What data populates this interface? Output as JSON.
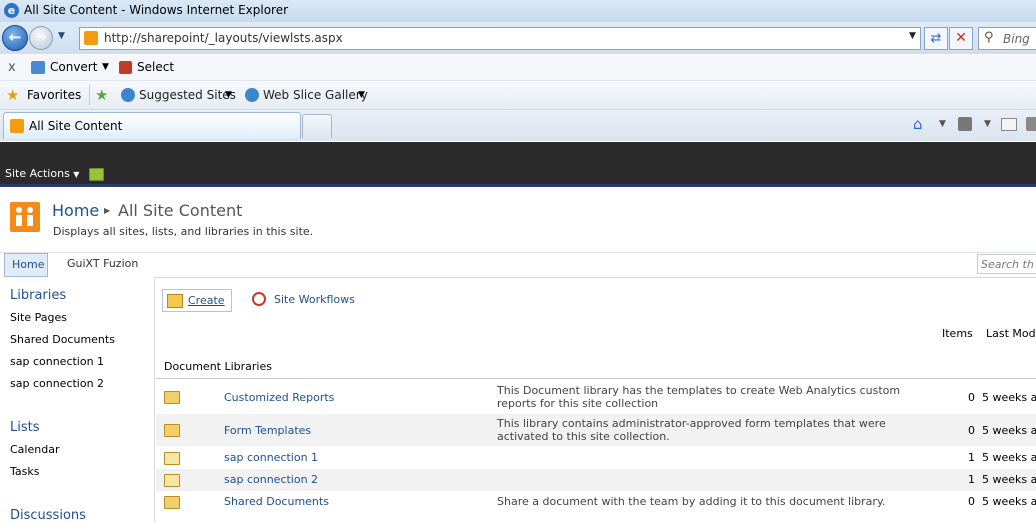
{
  "window": {
    "title": "All Site Content - Windows Internet Explorer"
  },
  "address": {
    "url": "http://sharepoint/_layouts/viewlsts.aspx",
    "search_placeholder": "Bing"
  },
  "toolbar": {
    "close": "x",
    "convert": "Convert",
    "select": "Select"
  },
  "favorites_bar": {
    "favorites": "Favorites",
    "suggested_sites": "Suggested Sites",
    "web_slice_gallery": "Web Slice Gallery"
  },
  "tabs": [
    {
      "label": "All Site Content"
    }
  ],
  "sharepoint": {
    "site_actions": "Site Actions",
    "breadcrumb": {
      "home": "Home",
      "current": "All Site Content"
    },
    "description": "Displays all sites, lists, and libraries in this site.",
    "top_nav": [
      "Home",
      "GuiXT Fuzion"
    ],
    "search_placeholder": "Search th"
  },
  "quick_launch": {
    "libraries": {
      "heading": "Libraries",
      "items": [
        "Site Pages",
        "Shared Documents",
        "sap connection 1",
        "sap connection 2"
      ]
    },
    "lists": {
      "heading": "Lists",
      "items": [
        "Calendar",
        "Tasks"
      ]
    },
    "discussions": {
      "heading": "Discussions"
    }
  },
  "content": {
    "create_label": "Create",
    "site_workflows_label": "Site Workflows",
    "columns": {
      "items": "Items",
      "last_modified": "Last Mod"
    },
    "section_title": "Document Libraries",
    "rows": [
      {
        "name": "Customized Reports",
        "description": "This Document library has the templates to create Web Analytics custom reports for this site collection",
        "count": "0",
        "modified": "5 weeks a"
      },
      {
        "name": "Form Templates",
        "description": "This library contains administrator-approved form templates that were activated to this site collection.",
        "count": "0",
        "modified": "5 weeks a"
      },
      {
        "name": "sap connection 1",
        "description": "",
        "count": "1",
        "modified": "5 weeks a"
      },
      {
        "name": "sap connection 2",
        "description": "",
        "count": "1",
        "modified": "5 weeks a"
      },
      {
        "name": "Shared Documents",
        "description": "Share a document with the team by adding it to this document library.",
        "count": "0",
        "modified": "5 weeks a"
      }
    ]
  },
  "colors": {
    "link": "#1f4f92",
    "ribbon_dark": "#2b2b2b",
    "site_logo": "#f28c18"
  }
}
